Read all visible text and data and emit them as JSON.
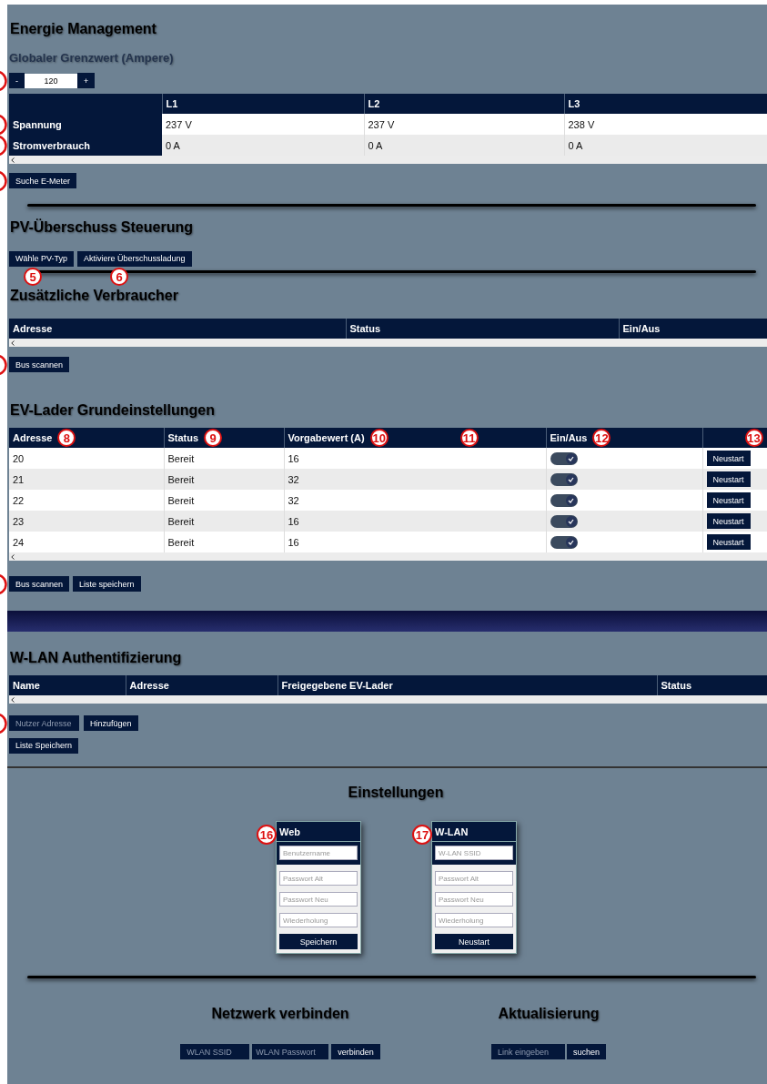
{
  "energy": {
    "title": "Energie Management",
    "subtitle": "Globaler Grenzwert (Ampere)",
    "limit": {
      "decrement": "-",
      "value": "120",
      "increment": "+",
      "edge_marker": true
    },
    "table": {
      "columns": [
        "L1",
        "L2",
        "L3"
      ],
      "rows": [
        {
          "label": "Spannung",
          "cells": [
            "237 V",
            "237 V",
            "238 V"
          ],
          "edge_marker": true
        },
        {
          "label": "Stromverbrauch",
          "cells": [
            "0 A",
            "0 A",
            "0 A"
          ],
          "edge_marker": true
        }
      ]
    },
    "search_button": {
      "label": "Suche E-Meter",
      "edge_marker": true
    }
  },
  "pv": {
    "title": "PV-Überschuss Steuerung",
    "buttons": [
      {
        "label": "Wähle PV-Typ",
        "callout": "5"
      },
      {
        "label": "Aktiviere Überschussladung",
        "callout": "6"
      }
    ]
  },
  "consumers": {
    "title": "Zusätzliche Verbraucher",
    "columns": [
      "Adresse",
      "Status",
      "Ein/Aus"
    ],
    "scan_button": {
      "label": "Bus scannen",
      "edge_marker": true
    }
  },
  "chargers": {
    "title": "EV-Lader Grundeinstellungen",
    "columns": [
      {
        "label": "Adresse",
        "callouts": [
          "8"
        ]
      },
      {
        "label": "Status",
        "callouts": [
          "9"
        ]
      },
      {
        "label": "Vorgabewert (A)",
        "callouts": [
          "10",
          "11"
        ]
      },
      {
        "label": "Ein/Aus",
        "callouts": [
          "12"
        ]
      },
      {
        "callouts": [
          "13"
        ]
      }
    ],
    "rows": [
      {
        "address": "20",
        "status": "Bereit",
        "setpoint": "16",
        "on": true,
        "action": "Neustart"
      },
      {
        "address": "21",
        "status": "Bereit",
        "setpoint": "32",
        "on": true,
        "action": "Neustart"
      },
      {
        "address": "22",
        "status": "Bereit",
        "setpoint": "32",
        "on": true,
        "action": "Neustart"
      },
      {
        "address": "23",
        "status": "Bereit",
        "setpoint": "16",
        "on": true,
        "action": "Neustart"
      },
      {
        "address": "24",
        "status": "Bereit",
        "setpoint": "16",
        "on": true,
        "action": "Neustart"
      }
    ],
    "buttons": [
      "Bus scannen",
      "Liste speichern"
    ],
    "edge_marker": true
  },
  "wlan_auth": {
    "title": "W-LAN Authentifizierung",
    "columns": [
      "Name",
      "Adresse",
      "Freigegebene EV-Lader",
      "Status"
    ],
    "address_field": {
      "placeholder": "Nutzer Adresse",
      "edge_marker": true
    },
    "add_button": "Hinzufügen",
    "save_button": "Liste Speichern"
  },
  "settings": {
    "title": "Einstellungen",
    "cards": [
      {
        "title": "Web",
        "callout": "16",
        "fields": [
          {
            "placeholder": "Benutzername"
          },
          {
            "placeholder": "Passwort Alt"
          },
          {
            "placeholder": "Passwort Neu"
          },
          {
            "placeholder": "Wiederholung"
          }
        ],
        "button": "Speichern"
      },
      {
        "title": "W-LAN",
        "callout": "17",
        "fields": [
          {
            "placeholder": "W-LAN SSID"
          },
          {
            "placeholder": "Passwort Alt"
          },
          {
            "placeholder": "Passwort Neu"
          },
          {
            "placeholder": "Wiederholung"
          }
        ],
        "button": "Neustart"
      }
    ]
  },
  "network": {
    "title": "Netzwerk verbinden",
    "ssid_placeholder": "WLAN SSID",
    "password_placeholder": "WLAN Passwort",
    "button": "verbinden"
  },
  "update": {
    "title": "Aktualisierung",
    "link_placeholder": "Link eingeben",
    "button": "suchen"
  }
}
